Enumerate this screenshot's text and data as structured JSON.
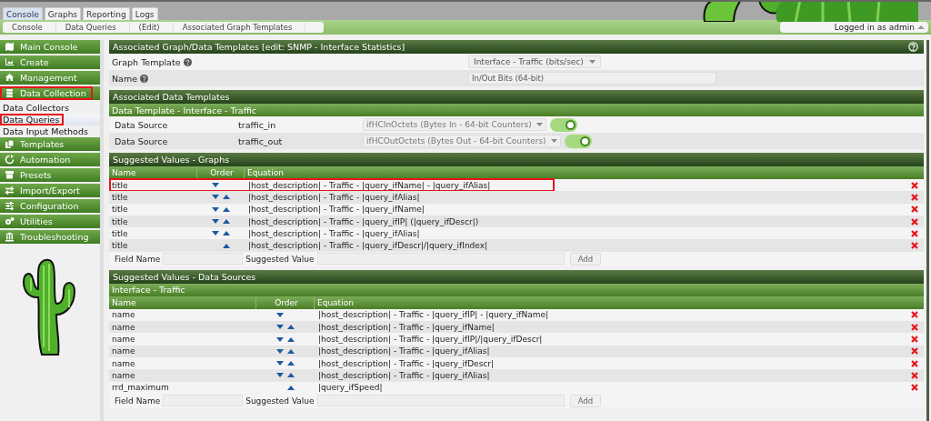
{
  "top_tabs": [
    {
      "label": "Console",
      "selected": true
    },
    {
      "label": "Graphs",
      "selected": false
    },
    {
      "label": "Reporting",
      "selected": false
    },
    {
      "label": "Logs",
      "selected": false
    }
  ],
  "breadcrumb": [
    "Console",
    "Data Queries",
    "(Edit)",
    "Associated Graph Templates"
  ],
  "user_menu": {
    "label": "Logged in as admin"
  },
  "sidebar": {
    "items": [
      {
        "label": "Main Console",
        "kind": "section",
        "highlighted": false
      },
      {
        "label": "Create",
        "kind": "section",
        "highlighted": false
      },
      {
        "label": "Management",
        "kind": "section",
        "highlighted": false
      },
      {
        "label": "Data Collection",
        "kind": "section",
        "highlighted": true
      },
      {
        "label": "Data Collectors",
        "kind": "link",
        "selected": false,
        "highlighted": false
      },
      {
        "label": "Data Queries",
        "kind": "link",
        "selected": true,
        "highlighted": true
      },
      {
        "label": "Data Input Methods",
        "kind": "link",
        "selected": false,
        "highlighted": false
      },
      {
        "label": "Templates",
        "kind": "section",
        "highlighted": false
      },
      {
        "label": "Automation",
        "kind": "section",
        "highlighted": false
      },
      {
        "label": "Presets",
        "kind": "section",
        "highlighted": false
      },
      {
        "label": "Import/Export",
        "kind": "section",
        "highlighted": false
      },
      {
        "label": "Configuration",
        "kind": "section",
        "highlighted": false
      },
      {
        "label": "Utilities",
        "kind": "section",
        "highlighted": false
      },
      {
        "label": "Troubleshooting",
        "kind": "section",
        "highlighted": false
      }
    ]
  },
  "template_panel": {
    "title": "Associated Graph/Data Templates [edit: SNMP - Interface Statistics]",
    "fields": [
      {
        "label": "Graph Template",
        "kind": "select",
        "value": "Interface - Traffic (bits/sec)"
      },
      {
        "label": "Name",
        "kind": "text",
        "value": "In/Out Bits (64-bit)"
      }
    ]
  },
  "data_templates": {
    "title": "Associated Data Templates",
    "subtitle": "Data Template - Interface - Traffic",
    "rows": [
      {
        "label": "Data Source",
        "name": "traffic_in",
        "value": "ifHCInOctets (Bytes In - 64-bit Counters)",
        "on": true
      },
      {
        "label": "Data Source",
        "name": "traffic_out",
        "value": "ifHCOutOctets (Bytes Out - 64-bit Counters)",
        "on": true
      }
    ]
  },
  "graph_values": {
    "title": "Suggested Values - Graphs",
    "columns": [
      "Name",
      "Order",
      "Equation"
    ],
    "rows": [
      {
        "name": "title",
        "down": true,
        "up": false,
        "equation": "|host_description| - Traffic - |query_ifName| - |query_ifAlias|",
        "highlighted": true
      },
      {
        "name": "title",
        "down": true,
        "up": true,
        "equation": "|host_description| - Traffic - |query_ifAlias|",
        "highlighted": false
      },
      {
        "name": "title",
        "down": true,
        "up": true,
        "equation": "|host_description| - Traffic - |query_ifName|",
        "highlighted": false
      },
      {
        "name": "title",
        "down": true,
        "up": true,
        "equation": "|host_description| - Traffic - |query_ifIP| (|query_ifDescr|)",
        "highlighted": false
      },
      {
        "name": "title",
        "down": true,
        "up": true,
        "equation": "|host_description| - Traffic - |query_ifAlias|",
        "highlighted": false
      },
      {
        "name": "title",
        "down": false,
        "up": true,
        "equation": "|host_description| - Traffic - |query_ifDescr|/|query_ifIndex|",
        "highlighted": false
      }
    ],
    "add_form": {
      "field_label": "Field Name",
      "value_label": "Suggested Value",
      "button": "Add"
    }
  },
  "ds_values": {
    "title": "Suggested Values - Data Sources",
    "subtitle": "Interface - Traffic",
    "columns": [
      "Name",
      "Order",
      "Equation"
    ],
    "rows": [
      {
        "name": "name",
        "down": true,
        "up": false,
        "equation": "|host_description| - Traffic - |query_ifIP| - |query_ifName|",
        "highlighted": false
      },
      {
        "name": "name",
        "down": true,
        "up": true,
        "equation": "|host_description| - Traffic - |query_ifName|",
        "highlighted": false
      },
      {
        "name": "name",
        "down": true,
        "up": true,
        "equation": "|host_description| - Traffic - |query_ifIP|/|query_ifDescr|",
        "highlighted": false
      },
      {
        "name": "name",
        "down": true,
        "up": true,
        "equation": "|host_description| - Traffic - |query_ifAlias|",
        "highlighted": false
      },
      {
        "name": "name",
        "down": true,
        "up": true,
        "equation": "|host_description| - Traffic - |query_ifDescr|",
        "highlighted": false
      },
      {
        "name": "name",
        "down": true,
        "up": true,
        "equation": "|host_description| - Traffic - |query_ifAlias|",
        "highlighted": false
      },
      {
        "name": "rrd_maximum",
        "down": false,
        "up": true,
        "equation": "|query_ifSpeed|",
        "highlighted": false
      }
    ],
    "add_form": {
      "field_label": "Field Name",
      "value_label": "Suggested Value",
      "button": "Add"
    }
  }
}
